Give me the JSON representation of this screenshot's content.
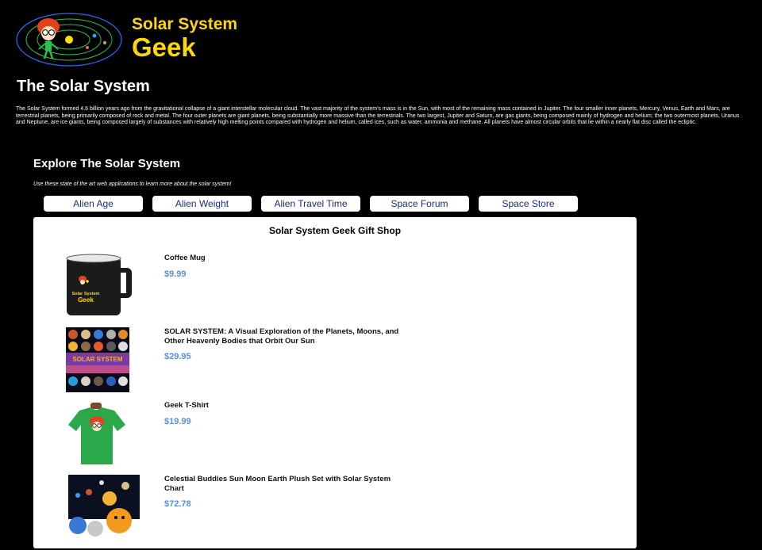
{
  "brand": {
    "line1": "Solar System",
    "line2": "Geek"
  },
  "page": {
    "title": "The Solar System",
    "intro": "The Solar System formed 4.6 billion years ago from the gravitational collapse of a giant interstellar molecular cloud. The vast majority of the system's mass is in the Sun, with most of the remaining mass contained in Jupiter. The four smaller inner planets, Mercury, Venus, Earth and Mars, are terrestrial planets, being primarily composed of rock and metal. The four outer planets are giant planets, being substantially more massive than the terrestrials. The two largest, Jupiter and Saturn, are gas giants, being composed mainly of hydrogen and helium; the two outermost planets, Uranus and Neptune, are ice giants, being composed largely of substances with relatively high melting points compared with hydrogen and helium, called ices, such as water, ammonia and methane. All planets have almost circular orbits that lie within a nearly flat disc called the ecliptic."
  },
  "explore": {
    "title": "Explore The Solar System",
    "subtitle": "Use these state of the art web applications to learn more about the solar system!",
    "nav": [
      "Alien Age",
      "Alien Weight",
      "Alien Travel Time",
      "Space Forum",
      "Space Store"
    ]
  },
  "shop": {
    "title": "Solar System Geek Gift Shop",
    "products": [
      {
        "name": "Coffee Mug",
        "price": "$9.99",
        "icon": "mug-image"
      },
      {
        "name": "SOLAR SYSTEM: A Visual Exploration of the Planets, Moons, and Other Heavenly Bodies that Orbit Our Sun",
        "price": "$29.95",
        "icon": "book-image"
      },
      {
        "name": "Geek T-Shirt",
        "price": "$19.99",
        "icon": "tshirt-image"
      },
      {
        "name": "Celestial Buddies Sun Moon Earth Plush Set with Solar System Chart",
        "price": "$72.78",
        "icon": "plush-set-image"
      }
    ],
    "mug_logo": {
      "line1": "Solar System",
      "line2": "Geek"
    },
    "book_title": "SOLAR SYSTEM"
  },
  "colors": {
    "brand_yellow": "#ffd800",
    "price_blue": "#5b8fd6",
    "nav_text": "#1a2a8a"
  }
}
